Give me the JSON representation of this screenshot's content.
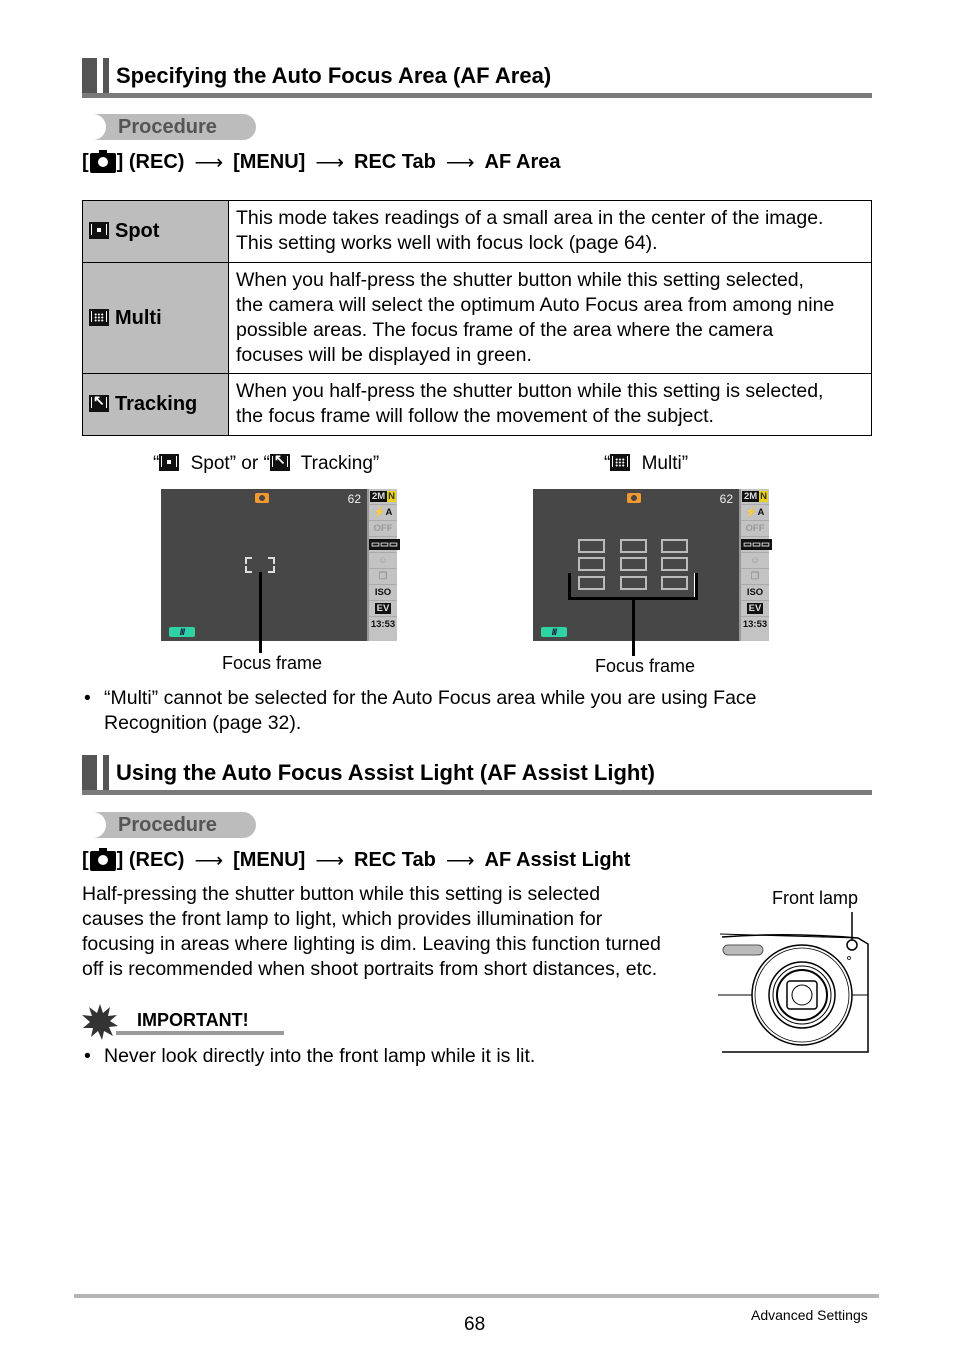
{
  "section1": {
    "title": "Specifying the Auto Focus Area (AF Area)",
    "procedure_label": "Procedure",
    "path": {
      "open_bracket": "[",
      "icon": "camera-icon",
      "close": "] (REC)",
      "step2": "[MENU]",
      "step3": "REC Tab",
      "step4": "AF Area",
      "arrow": "⟶"
    },
    "table": [
      {
        "icon": "spot-icon",
        "label": "Spot",
        "lines": [
          "This mode takes readings of a small area in the center of the image.",
          "This setting works well with focus lock (page 64)."
        ]
      },
      {
        "icon": "multi-icon",
        "label": "Multi",
        "lines": [
          "When you half-press the shutter button while this setting selected,",
          "the camera will select the optimum Auto Focus area from among nine",
          "possible areas. The focus frame of the area where the camera",
          "focuses will be displayed in green."
        ]
      },
      {
        "icon": "tracking-icon",
        "label": "Tracking",
        "lines": [
          "When you half-press the shutter button while this setting is selected,",
          "the focus frame will follow the movement of the subject."
        ]
      }
    ],
    "figures": {
      "left_caption": {
        "q1": "“",
        "spot": " Spot” or “",
        "tracking": " Tracking”"
      },
      "right_caption": {
        "q1": "“",
        "multi": " Multi”"
      },
      "screen": {
        "shots_remaining": "62",
        "time": "13:53",
        "side_icons": [
          "2M N",
          "⚡A",
          "OFF A",
          "▭▭▭",
          "face",
          "burst",
          "ISO",
          "EV",
          "13:53"
        ]
      },
      "focus_frame_label": "Focus frame"
    },
    "note": "“Multi” cannot be selected for the Auto Focus area while you are using Face",
    "note_line2": "Recognition (page 32)."
  },
  "section2": {
    "title": "Using the Auto Focus Assist Light (AF Assist Light)",
    "procedure_label": "Procedure",
    "path": {
      "open_bracket": "[",
      "icon": "camera-icon",
      "close": "] (REC)",
      "step2": "[MENU]",
      "step3": "REC Tab",
      "step4": "AF Assist Light",
      "arrow": "⟶"
    },
    "body_lines": [
      "Half-pressing the shutter button while this setting is selected",
      "causes the front lamp to light, which provides illumination for",
      "focusing in areas where lighting is dim. Leaving this function turned",
      "off is recommended when shoot portraits from short distances, etc."
    ],
    "front_lamp_label": "Front lamp",
    "important_label": "IMPORTANT!",
    "important_note": "Never look directly into the front lamp while it is lit."
  },
  "footer": {
    "page_number": "68",
    "section_name": "Advanced Settings"
  },
  "colors": {
    "heading_bar": "#555555",
    "heading_rule": "#7a7a7a",
    "procedure_pill": "#bcbcbc",
    "table_key_bg": "#bdbdbd",
    "lcd_bg": "#474747",
    "lcd_camera_icon": "#f29a2e",
    "battery": "#2ed3a4"
  }
}
